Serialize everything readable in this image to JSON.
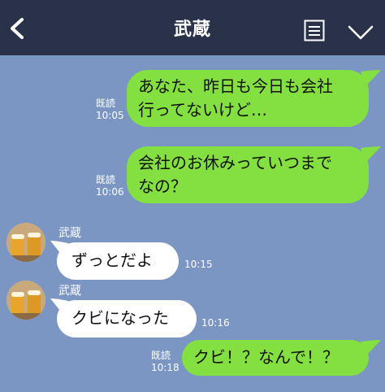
{
  "header": {
    "title": "武蔵",
    "back_icon": "chevron-left-icon",
    "menu_icon": "notes-icon",
    "more_icon": "chevron-down-icon",
    "bg_color": "#293248"
  },
  "colors": {
    "background": "#7b96c3",
    "outgoing_bubble": "#84e041",
    "incoming_bubble": "#ffffff"
  },
  "messages": [
    {
      "direction": "out",
      "line1": "あなた、昨日も今日も会社",
      "line2": "行ってないけど…",
      "read": "既読",
      "time": "10:05"
    },
    {
      "direction": "out",
      "line1": "会社のお休みっていつまで",
      "line2": "なの？",
      "read": "既読",
      "time": "10:06"
    },
    {
      "direction": "in",
      "sender": "武蔵",
      "text": "ずっとだよ",
      "time": "10:15"
    },
    {
      "direction": "in",
      "sender": "武蔵",
      "text": "クビになった",
      "time": "10:16"
    },
    {
      "direction": "out",
      "text": "クビ！？なんで！？",
      "read": "既読",
      "time": "10:18"
    }
  ]
}
